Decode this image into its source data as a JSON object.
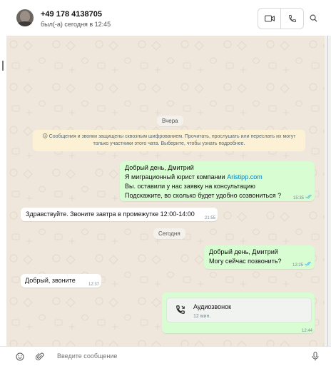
{
  "header": {
    "contact_name": "+49 178 4138705",
    "status": "был(-а) сегодня в 12:45",
    "icons": [
      "video-call-icon",
      "voice-call-icon",
      "search-icon"
    ]
  },
  "chat": {
    "date_yesterday": "Вчера",
    "encryption_notice_line1": "🛈 Сообщения и звонки защищены сквозным шифрованием. Прочитать, прослушать или переслать их могут",
    "encryption_notice_line2": "только участники этого чата. Выберите, чтобы узнать подробнее.",
    "msg1": {
      "line1": "Добрый день, Дмитрий",
      "line2_prefix": "Я миграционный юрист компании ",
      "line2_link": "Aristipp.com",
      "line3": "Вы. оставили у нас заявку на консультацию",
      "line4": "Подскажите, во сколько будет удобно созвониться ?",
      "time": "15:35"
    },
    "msg2": {
      "text": "Здравствуйте. Звоните завтра в промежутке 12:00-14:00",
      "time": "21:55"
    },
    "date_today": "Сегодня",
    "msg3": {
      "line1": "Добрый день, Дмитрий",
      "line2": "Могу сейчас позвонить?",
      "time": "12:25"
    },
    "msg4": {
      "text": "Добрый, звоните",
      "time": "12:37"
    },
    "msg5": {
      "call_title": "Аудиозвонок",
      "call_duration": "12 мин.",
      "time": "12:44"
    }
  },
  "composer": {
    "placeholder": "Введите сообщение",
    "icons": [
      "emoji-icon",
      "attach-icon",
      "microphone-icon"
    ]
  },
  "colors": {
    "chat_background": "#efe7dc",
    "outgoing_bubble": "#d9fdd3",
    "incoming_bubble": "#ffffff",
    "read_ticks": "#53bdeb",
    "notice_background": "#fdf1d5",
    "link": "#027eb5"
  }
}
